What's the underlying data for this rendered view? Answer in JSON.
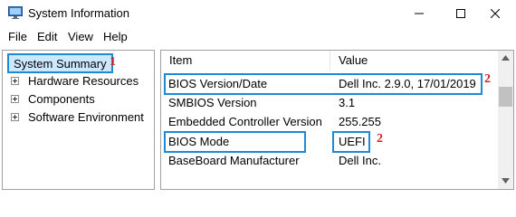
{
  "window": {
    "title": "System Information",
    "icon": "monitor-icon",
    "controls": [
      "minimize-icon",
      "maximize-icon",
      "close-icon"
    ]
  },
  "menu": {
    "items": [
      {
        "label": "File"
      },
      {
        "label": "Edit"
      },
      {
        "label": "View"
      },
      {
        "label": "Help"
      }
    ]
  },
  "tree": {
    "root": "System Summary",
    "children": [
      {
        "label": "Hardware Resources"
      },
      {
        "label": "Components"
      },
      {
        "label": "Software Environment"
      }
    ]
  },
  "table": {
    "columns": [
      "Item",
      "Value"
    ],
    "rows": [
      {
        "item": "BIOS Version/Date",
        "value": "Dell Inc. 2.9.0, 17/01/2019"
      },
      {
        "item": "SMBIOS Version",
        "value": "3.1"
      },
      {
        "item": "Embedded Controller Version",
        "value": "255.255"
      },
      {
        "item": "BIOS Mode",
        "value": "UEFI"
      },
      {
        "item": "BaseBoard Manufacturer",
        "value": "Dell Inc."
      }
    ]
  },
  "annotations": {
    "step1": "1",
    "step2a": "2",
    "step2b": "2",
    "color": "#d42020",
    "highlight_color": "#1f8ad2"
  }
}
